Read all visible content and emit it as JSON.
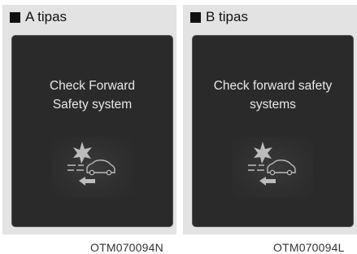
{
  "panels": [
    {
      "title": "A tipas",
      "message_lines": [
        "Check Forward",
        "Safety system"
      ],
      "code": "OTM070094N"
    },
    {
      "title": "B tipas",
      "message_lines": [
        "Check forward safety",
        "systems"
      ],
      "code": "OTM070094L"
    }
  ],
  "icons": {
    "header_marker": "square-bullet-icon",
    "warning": "forward-collision-warning-icon"
  },
  "colors": {
    "panel_background": "#e3e3e3",
    "screen_background": "#2a2a2a",
    "screen_text": "#e8e8e8",
    "icon_color": "#bcbcbc"
  }
}
